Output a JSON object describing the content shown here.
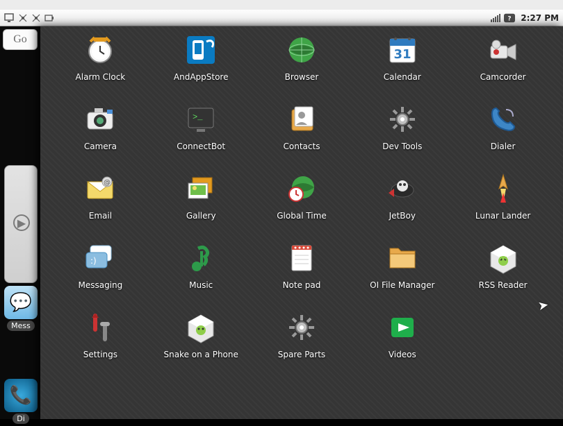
{
  "status": {
    "time": "2:27 PM",
    "icons_left": [
      "monitor-icon",
      "radio-icon",
      "radio2-icon",
      "battery-icon"
    ],
    "icons_right": [
      "signal-icon",
      "3g-icon"
    ]
  },
  "home": {
    "search_text": "Go",
    "shortcuts": [
      {
        "id": "messaging",
        "label": "Mess"
      },
      {
        "id": "dialer",
        "label": "Di"
      }
    ]
  },
  "drawer": {
    "apps": [
      {
        "id": "alarm-clock",
        "label": "Alarm Clock"
      },
      {
        "id": "andappstore",
        "label": "AndAppStore"
      },
      {
        "id": "browser",
        "label": "Browser"
      },
      {
        "id": "calendar",
        "label": "Calendar",
        "day": "31"
      },
      {
        "id": "camcorder",
        "label": "Camcorder"
      },
      {
        "id": "camera",
        "label": "Camera"
      },
      {
        "id": "connectbot",
        "label": "ConnectBot"
      },
      {
        "id": "contacts",
        "label": "Contacts"
      },
      {
        "id": "dev-tools",
        "label": "Dev Tools"
      },
      {
        "id": "dialer",
        "label": "Dialer"
      },
      {
        "id": "email",
        "label": "Email"
      },
      {
        "id": "gallery",
        "label": "Gallery"
      },
      {
        "id": "global-time",
        "label": "Global Time"
      },
      {
        "id": "jetboy",
        "label": "JetBoy"
      },
      {
        "id": "lunar-lander",
        "label": "Lunar Lander"
      },
      {
        "id": "messaging",
        "label": "Messaging"
      },
      {
        "id": "music",
        "label": "Music"
      },
      {
        "id": "notepad",
        "label": "Note pad"
      },
      {
        "id": "oi-file-manager",
        "label": "OI File Manager"
      },
      {
        "id": "rss-reader",
        "label": "RSS Reader"
      },
      {
        "id": "settings",
        "label": "Settings"
      },
      {
        "id": "snake",
        "label": "Snake on a Phone"
      },
      {
        "id": "spare-parts",
        "label": "Spare Parts"
      },
      {
        "id": "videos",
        "label": "Videos"
      }
    ]
  }
}
